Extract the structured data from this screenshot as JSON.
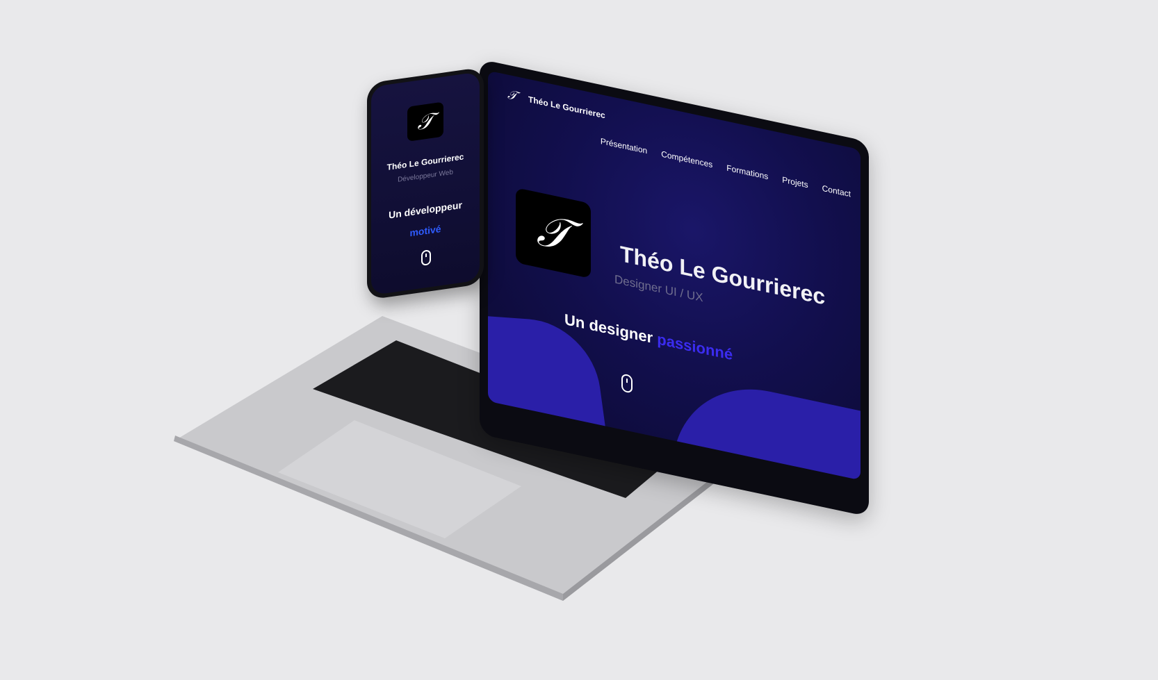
{
  "laptop": {
    "nav": {
      "logo_glyph": "𝒯",
      "site_name": "Théo Le Gourrierec",
      "menu": [
        "Présentation",
        "Compétences",
        "Formations",
        "Projets",
        "Contact"
      ]
    },
    "hero": {
      "logo_glyph": "𝒯",
      "name": "Théo Le Gourrierec",
      "role": "Designer UI / UX",
      "tagline_lead": "Un designer",
      "tagline_accent": "passionné"
    }
  },
  "phone": {
    "logo_glyph": "𝒯",
    "name": "Théo Le Gourrierec",
    "role": "Développeur Web",
    "tagline_line1": "Un développeur",
    "tagline_line2": "motivé"
  },
  "colors": {
    "background": "#e9e9eb",
    "screen_bg": "#120f4e",
    "accent_laptop": "#3b2cf0",
    "accent_phone": "#2f5cff"
  }
}
